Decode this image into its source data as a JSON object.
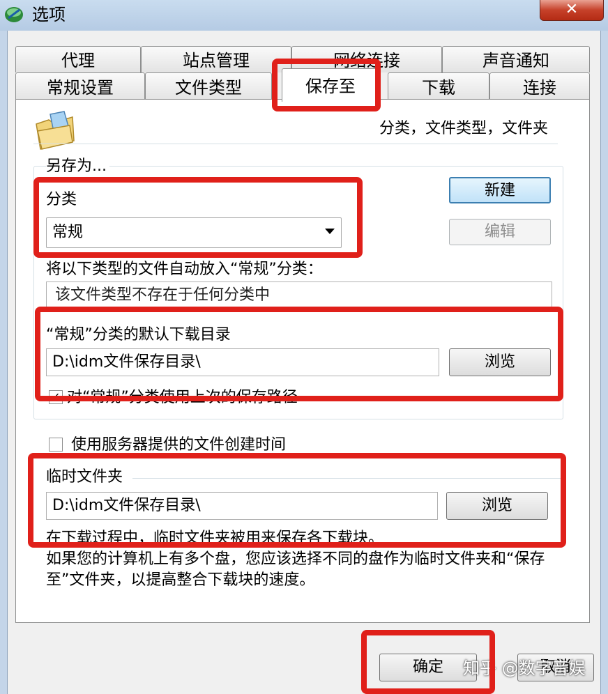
{
  "window": {
    "title": "选项",
    "close_glyph": "✕"
  },
  "tabs": {
    "row1": [
      "代理",
      "站点管理",
      "网络连接",
      "声音通知"
    ],
    "row2": [
      "常规设置",
      "文件类型",
      "保存至",
      "下载",
      "连接"
    ],
    "active": "保存至"
  },
  "header": {
    "text": "分类，文件类型，文件夹",
    "icon": "folder-icon"
  },
  "save_as": {
    "label": "另存为...",
    "category_label": "分类",
    "category_value": "常规",
    "new_button": "新建",
    "edit_button": "编辑",
    "auto_types_label": "将以下类型的文件自动放入“常规”分类：",
    "types_value": "该文件类型不存在于任何分类中",
    "default_dir_label": "“常规”分类的默认下载目录",
    "default_dir_value": "D:\\idm文件保存目录\\",
    "browse_button": "浏览",
    "last_path_label": "对“常规”分类使用上次的保存路径",
    "last_path_checked": true
  },
  "server_time": {
    "label": "使用服务器提供的文件创建时间",
    "checked": false
  },
  "temp_folder": {
    "label": "临时文件夹",
    "value": "D:\\idm文件保存目录\\",
    "browse_button": "浏览",
    "description": "在下载过程中，临时文件夹被用来保存各下载块。",
    "multi_disk_note": "如果您的计算机上有多个盘，您应该选择不同的盘作为临时文件夹和“保存至”文件夹，以提高整合下载块的速度。"
  },
  "footer": {
    "ok_button": "确定",
    "cancel_button": "取消"
  },
  "watermark": "知乎 @数字音娱",
  "highlight_color": "#e0201a"
}
